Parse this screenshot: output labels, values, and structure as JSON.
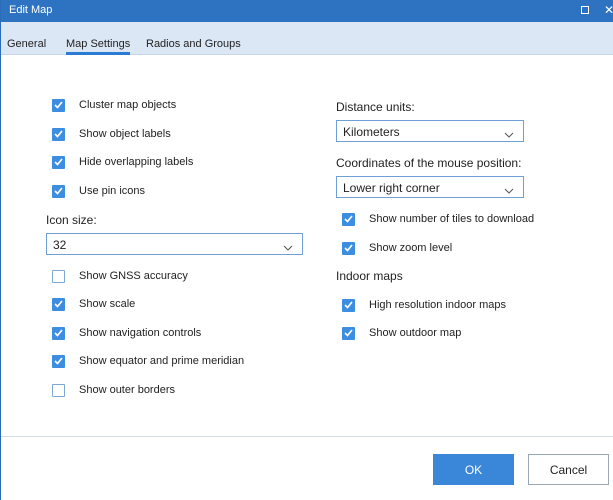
{
  "window": {
    "title": "Edit Map"
  },
  "tabs": [
    {
      "label": "General"
    },
    {
      "label": "Map Settings",
      "active": true
    },
    {
      "label": "Radios and Groups"
    }
  ],
  "left": {
    "checkboxes_top": [
      {
        "label": "Cluster map objects",
        "checked": true
      },
      {
        "label": "Show object labels",
        "checked": true
      },
      {
        "label": "Hide overlapping labels",
        "checked": true
      },
      {
        "label": "Use pin icons",
        "checked": true
      }
    ],
    "icon_size": {
      "label": "Icon size:",
      "value": "32"
    },
    "checkboxes_bottom": [
      {
        "label": "Show GNSS accuracy",
        "checked": false
      },
      {
        "label": "Show scale",
        "checked": true
      },
      {
        "label": "Show navigation controls",
        "checked": true
      },
      {
        "label": "Show equator and prime meridian",
        "checked": true
      },
      {
        "label": "Show outer borders",
        "checked": false
      }
    ]
  },
  "right": {
    "distance_units": {
      "label": "Distance units:",
      "value": "Kilometers"
    },
    "mouse_coords": {
      "label": "Coordinates of the mouse position:",
      "value": "Lower right corner"
    },
    "checkboxes_mid": [
      {
        "label": "Show number of tiles to download",
        "checked": true
      },
      {
        "label": "Show zoom level",
        "checked": true
      }
    ],
    "indoor_heading": "Indoor maps",
    "checkboxes_indoor": [
      {
        "label": "High resolution indoor maps",
        "checked": true
      },
      {
        "label": "Show outdoor map",
        "checked": true
      }
    ]
  },
  "footer": {
    "ok_label": "OK",
    "cancel_label": "Cancel"
  },
  "colors": {
    "titlebar": "#2e72c2",
    "tabbar": "#dbe7f5",
    "accent": "#3a86d8",
    "checkbox_checked": "#3d8ee0"
  }
}
